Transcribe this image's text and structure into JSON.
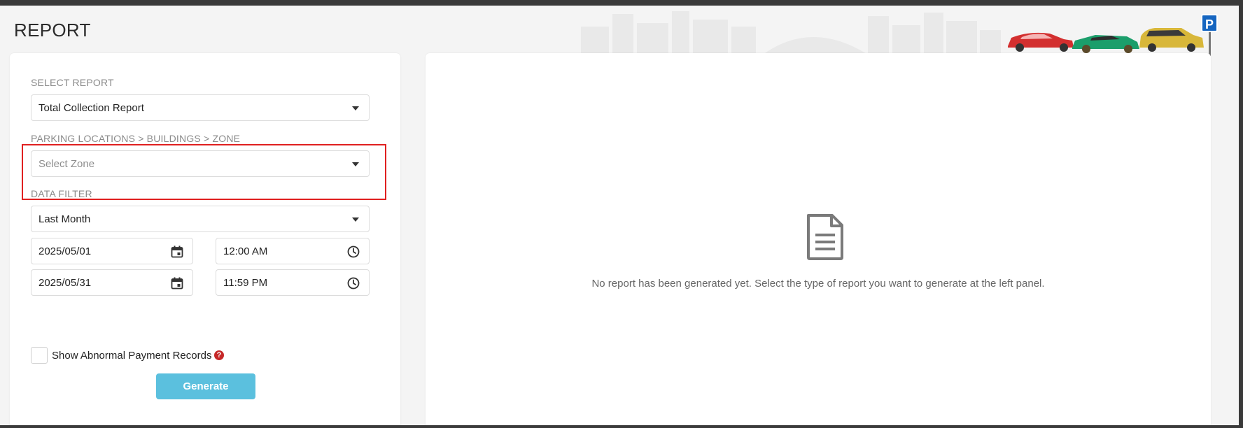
{
  "page": {
    "title": "REPORT"
  },
  "header": {
    "parking_sign": "P"
  },
  "left_panel": {
    "select_report": {
      "label": "SELECT REPORT",
      "value": "Total Collection Report"
    },
    "location": {
      "label": "PARKING LOCATIONS > BUILDINGS > ZONE",
      "placeholder": "Select Zone"
    },
    "data_filter": {
      "label": "DATA FILTER",
      "value": "Last Month"
    },
    "start_date": "2025/05/01",
    "start_time": "12:00 AM",
    "end_date": "2025/05/31",
    "end_time": "11:59 PM",
    "abnormal_checkbox": {
      "label": "Show Abnormal Payment Records",
      "checked": false
    },
    "help_symbol": "?",
    "generate_label": "Generate"
  },
  "right_panel": {
    "empty_message": "No report has been generated yet. Select the type of report you want to generate at the left panel."
  },
  "colors": {
    "accent": "#5bc0de",
    "highlight": "#e02020",
    "help": "#c62828",
    "sign": "#1565c0"
  },
  "icons": {
    "date": "calendar-icon",
    "time": "clock-icon",
    "empty_state": "document-icon",
    "help": "question-circle-icon",
    "dropdown": "caret-down-icon"
  }
}
